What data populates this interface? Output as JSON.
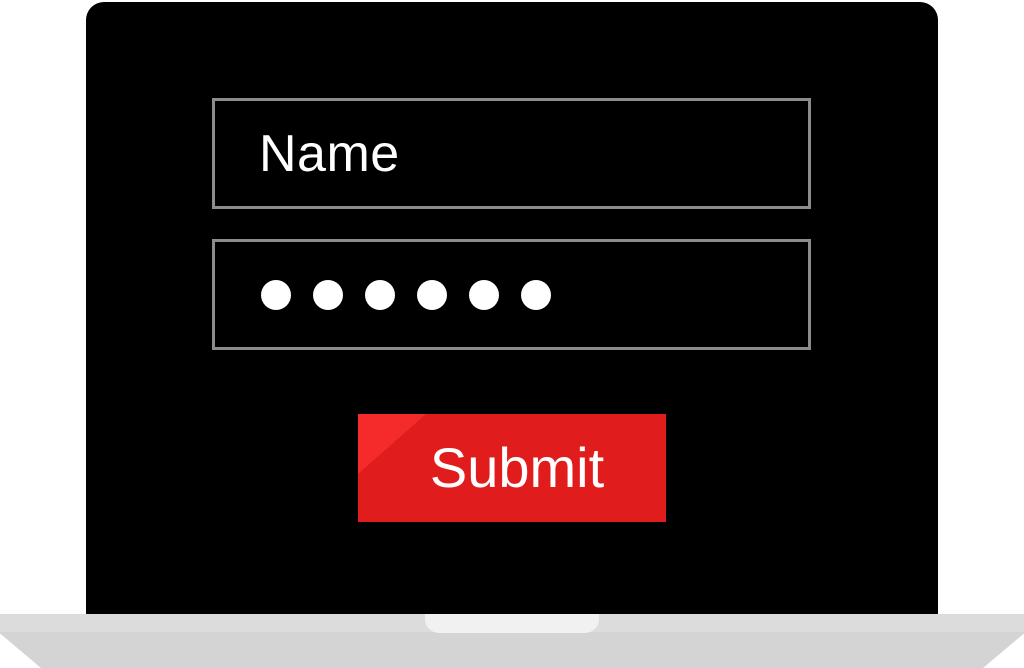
{
  "form": {
    "name_field": {
      "value": "Name"
    },
    "password_field": {
      "masked_length": 6
    },
    "submit_label": "Submit"
  },
  "colors": {
    "screen": "#000000",
    "field_border": "#8c8c8c",
    "submit_background": "#e11c1c",
    "laptop_base": "#d4d4d4"
  }
}
